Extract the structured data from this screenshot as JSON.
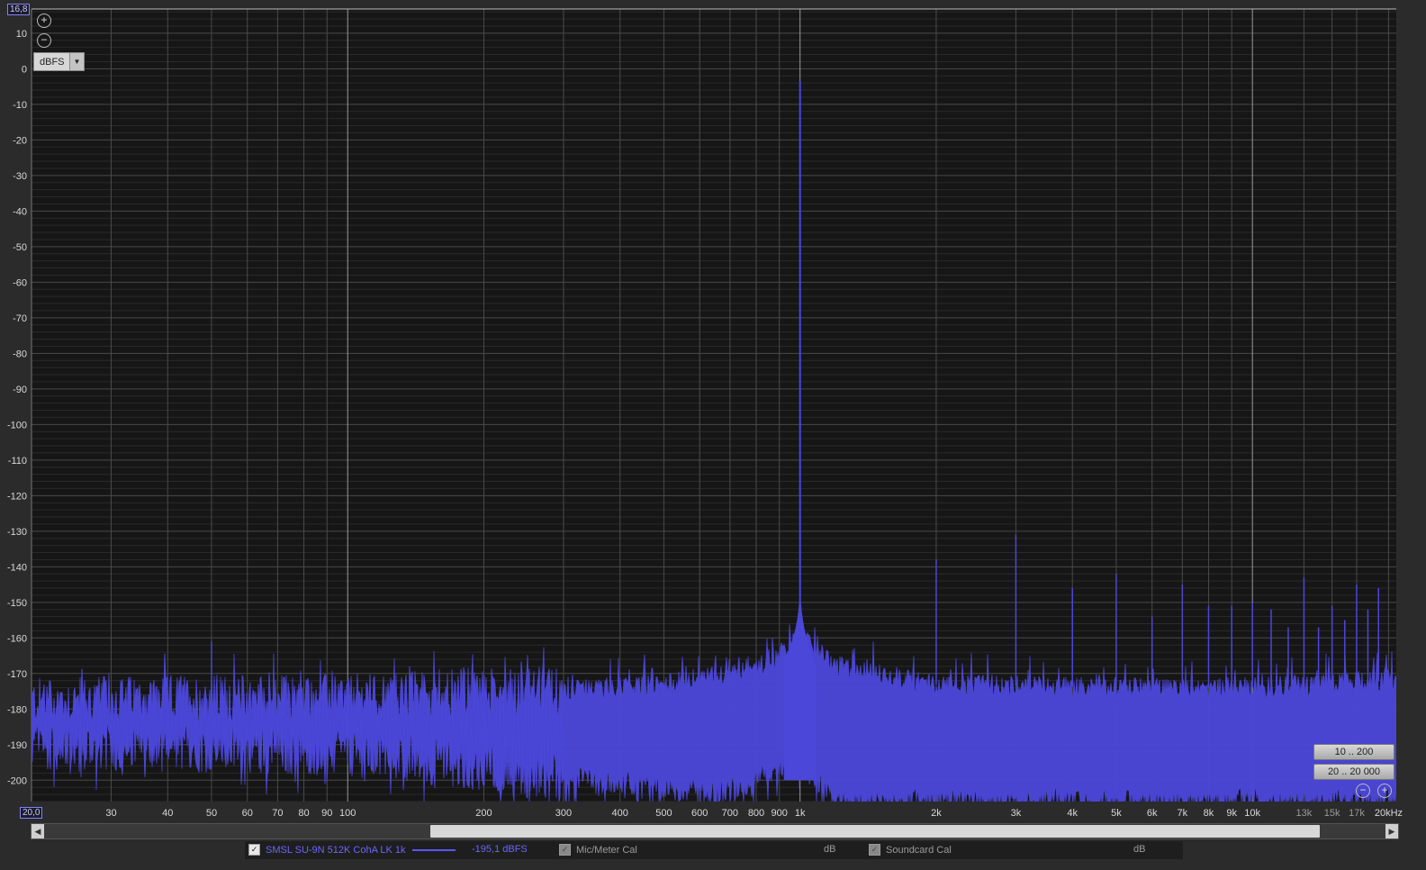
{
  "chart_data": {
    "type": "line",
    "xscale": "log",
    "xlim": [
      20,
      20800
    ],
    "ylim": [
      -206,
      16.8
    ],
    "y_ticks": [
      10,
      0,
      -10,
      -20,
      -30,
      -40,
      -50,
      -60,
      -70,
      -80,
      -90,
      -100,
      -110,
      -120,
      -130,
      -140,
      -150,
      -160,
      -170,
      -180,
      -190,
      -200
    ],
    "x_ticks": [
      {
        "v": 30,
        "label": "30"
      },
      {
        "v": 40,
        "label": "40"
      },
      {
        "v": 50,
        "label": "50"
      },
      {
        "v": 60,
        "label": "60"
      },
      {
        "v": 70,
        "label": "70"
      },
      {
        "v": 80,
        "label": "80"
      },
      {
        "v": 90,
        "label": "90"
      },
      {
        "v": 100,
        "label": "100"
      },
      {
        "v": 200,
        "label": "200"
      },
      {
        "v": 300,
        "label": "300"
      },
      {
        "v": 400,
        "label": "400"
      },
      {
        "v": 500,
        "label": "500"
      },
      {
        "v": 600,
        "label": "600"
      },
      {
        "v": 700,
        "label": "700"
      },
      {
        "v": 800,
        "label": "800"
      },
      {
        "v": 900,
        "label": "900"
      },
      {
        "v": 1000,
        "label": "1k"
      },
      {
        "v": 2000,
        "label": "2k"
      },
      {
        "v": 3000,
        "label": "3k"
      },
      {
        "v": 4000,
        "label": "4k"
      },
      {
        "v": 5000,
        "label": "5k"
      },
      {
        "v": 6000,
        "label": "6k"
      },
      {
        "v": 7000,
        "label": "7k"
      },
      {
        "v": 8000,
        "label": "8k"
      },
      {
        "v": 9000,
        "label": "9k"
      },
      {
        "v": 10000,
        "label": "10k"
      },
      {
        "v": 13000,
        "label": "13k"
      },
      {
        "v": 15000,
        "label": "15k"
      },
      {
        "v": 17000,
        "label": "17k"
      },
      {
        "v": 20000,
        "label": "20kHz"
      }
    ],
    "emphasized_x_gridlines": [
      100,
      1000,
      10000
    ],
    "grid": true,
    "series": [
      {
        "name": "SMSL SU-9N 512K CohA LK 1k",
        "color": "#4b47d8",
        "fill": true,
        "noise_floor": {
          "x": [
            20,
            50,
            100,
            200,
            300,
            500,
            700,
            850,
            950,
            1000,
            1050,
            1200,
            2000,
            5000,
            10000,
            20000
          ],
          "y_top": [
            -178,
            -177,
            -177,
            -175,
            -175,
            -173,
            -170,
            -167,
            -162,
            -160,
            -162,
            -168,
            -173,
            -174,
            -174,
            -172
          ],
          "y_bottom": [
            -190,
            -191,
            -192,
            -196,
            -200,
            -202,
            -203,
            -198,
            -195,
            -193,
            -197,
            -206,
            -206,
            -206,
            -206,
            -206
          ]
        },
        "peaks": [
          {
            "x": 50,
            "y": -161
          },
          {
            "x": 1000,
            "y": -3.5
          },
          {
            "x": 2000,
            "y": -138
          },
          {
            "x": 3000,
            "y": -131
          },
          {
            "x": 4000,
            "y": -146
          },
          {
            "x": 5000,
            "y": -142
          },
          {
            "x": 6000,
            "y": -154
          },
          {
            "x": 7000,
            "y": -145
          },
          {
            "x": 8000,
            "y": -151
          },
          {
            "x": 9000,
            "y": -151
          },
          {
            "x": 10000,
            "y": -150
          },
          {
            "x": 11000,
            "y": -152
          },
          {
            "x": 12000,
            "y": -157
          },
          {
            "x": 13000,
            "y": -143
          },
          {
            "x": 14000,
            "y": -157
          },
          {
            "x": 15000,
            "y": -151
          },
          {
            "x": 16000,
            "y": -155
          },
          {
            "x": 17000,
            "y": -145
          },
          {
            "x": 18000,
            "y": -152
          },
          {
            "x": 19000,
            "y": -146
          }
        ]
      }
    ]
  },
  "ui": {
    "top_corner_value": "16,8",
    "bottom_corner_value": "20,0",
    "unit": "dBFS",
    "preset_1": "10 .. 200",
    "preset_2": "20 .. 20 000",
    "legend": {
      "trace_name": "SMSL SU-9N 512K CohA LK 1k",
      "trace_value": "-195,1 dBFS",
      "cal1_label": "Mic/Meter Cal",
      "cal1_unit": "dB",
      "cal2_label": "Soundcard Cal",
      "cal2_unit": "dB"
    },
    "colors": {
      "plot_bg": "#161616",
      "trace": "#4b47d8",
      "legend_text": "#6a66ff"
    }
  }
}
